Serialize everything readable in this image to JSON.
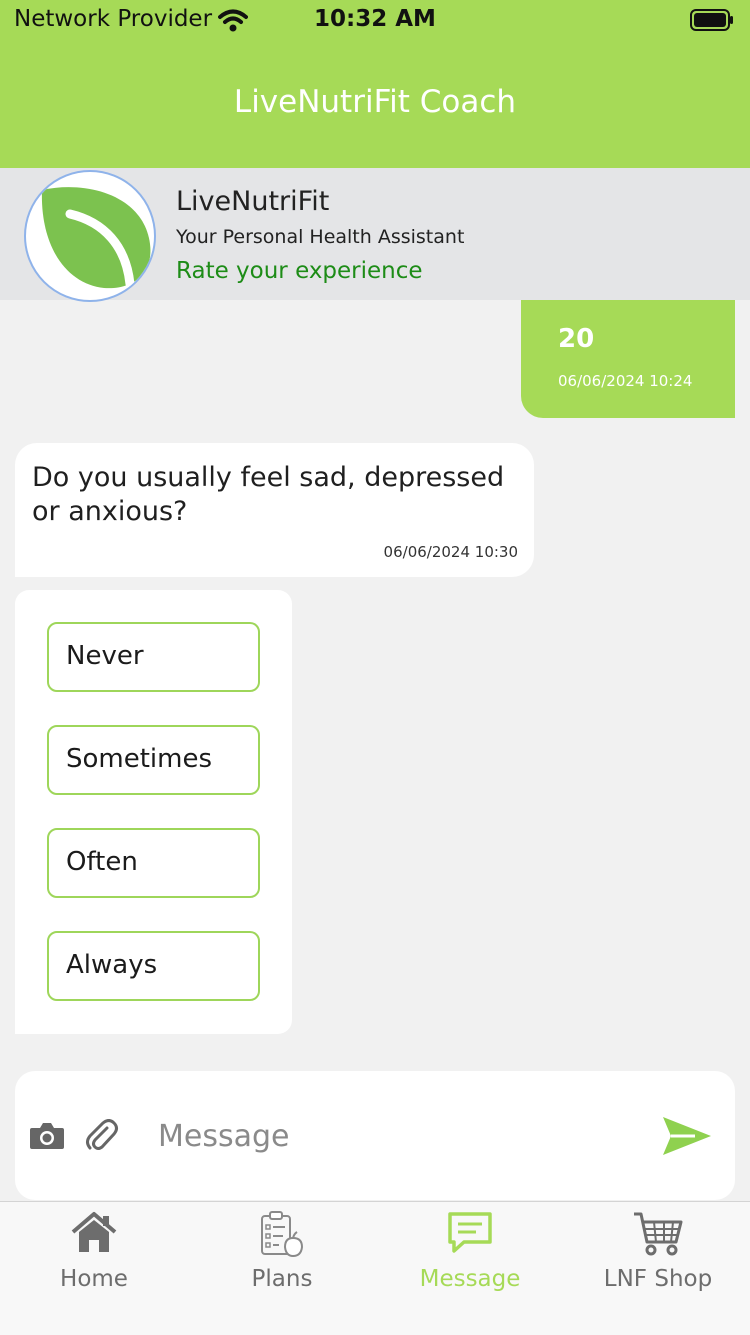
{
  "status_bar": {
    "carrier": "Network Provider",
    "time": "10:32 AM"
  },
  "header": {
    "title": "LiveNutriFit Coach"
  },
  "profile": {
    "name": "LiveNutriFit",
    "subtitle": "Your Personal Health Assistant",
    "rate_link": "Rate your experience"
  },
  "messages": {
    "user": {
      "text": "20",
      "time": "06/06/2024  10:24"
    },
    "bot": {
      "text": "Do you usually feel sad, depressed or anxious?",
      "time": "06/06/2024  10:30"
    }
  },
  "options": [
    "Never",
    "Sometimes",
    "Often",
    "Always"
  ],
  "composer": {
    "placeholder": "Message"
  },
  "tabs": [
    {
      "label": "Home",
      "icon": "home-icon"
    },
    {
      "label": "Plans",
      "icon": "plans-icon"
    },
    {
      "label": "Message",
      "icon": "message-icon",
      "active": true
    },
    {
      "label": "LNF Shop",
      "icon": "shop-cart-icon"
    }
  ],
  "colors": {
    "brand_green": "#a6da57",
    "link_green": "#1d8c17",
    "profile_bg": "#e4e5e7",
    "chat_bg": "#f1f1f1"
  }
}
